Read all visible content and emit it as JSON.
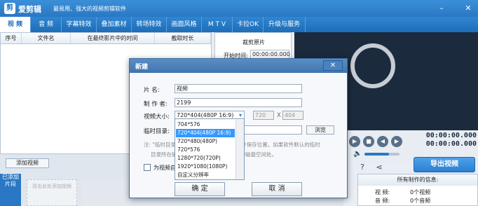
{
  "app": {
    "name": "爱剪辑",
    "slogan": "最易用、强大的视频剪辑软件"
  },
  "tabs": [
    {
      "label": "视 频",
      "active": true
    },
    {
      "label": "音 频"
    },
    {
      "label": "字幕特效"
    },
    {
      "label": "叠加素材"
    },
    {
      "label": "转场特效"
    },
    {
      "label": "画面风格"
    },
    {
      "label": "M T V"
    },
    {
      "label": "卡拉OK"
    },
    {
      "label": "升级与服务"
    }
  ],
  "table": {
    "headers": [
      "序号",
      "文件名",
      "在最终影片中的时间",
      "截取时长"
    ]
  },
  "clip_panel": {
    "title": "裁剪原片",
    "start_label": "开始时间:",
    "start_value": "00:00:00.000"
  },
  "player": {
    "time_current": "00:00:00.000",
    "time_total": "00:00:00.000"
  },
  "export_button": "导出视频",
  "add_video_button": "添加视频",
  "sidebar_tab": "已添加片段",
  "slot_hint": "双击此处添加视频",
  "info_panel": {
    "title": "所有制作的信息:",
    "rows": [
      {
        "label": "视 频:",
        "value": "0个视频"
      },
      {
        "label": "音 频:",
        "value": "0个音频"
      }
    ]
  },
  "dialog": {
    "title": "新建",
    "name_label": "片 名:",
    "name_value": "视频",
    "author_label": "制 作 者:",
    "author_value": "2199",
    "size_label": "视频大小:",
    "size_value": "720*404(480P 16:9)",
    "width_value": "720",
    "x_sep": "X",
    "height_value": "404",
    "temp_label": "临时目录:",
    "browse_label": "浏览",
    "note_line1": "注: \"临时目录\"用于保存临时文件，设定文件保存位置。如果软件默认的临时",
    "note_line2": "目录所在磁盘空间不足，请设定到更大的磁盘空间处。",
    "checkbox_label": "为视频自动添加片头",
    "ok_label": "确 定",
    "cancel_label": "取 消",
    "size_options": [
      "704*576",
      "720*404(480P 16:9)",
      "720*480(480P)",
      "720*576",
      "1280*720(720P)",
      "1920*1080(1080P)",
      "自定义分辨率"
    ],
    "selected_index": 1
  }
}
